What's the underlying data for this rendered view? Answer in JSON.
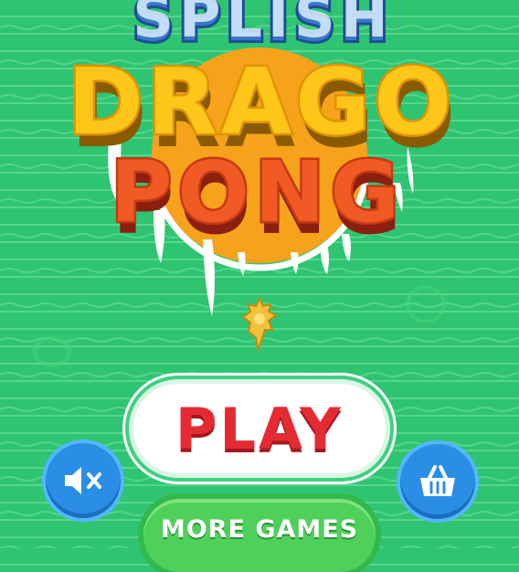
{
  "title": {
    "line1": "SPLISH",
    "line2": "DRAGO",
    "line3": "PONG"
  },
  "buttons": {
    "play_label": "PLAY",
    "more_games_label": "MORE GAMES",
    "sound_icon": "speaker-muted-icon",
    "shop_icon": "basket-icon"
  },
  "colors": {
    "background": "#2fc472",
    "title_yellow": "#ffc61a",
    "title_orange": "#f15a24",
    "play_red": "#e42b34",
    "round_button_blue": "#2b8ee6"
  }
}
